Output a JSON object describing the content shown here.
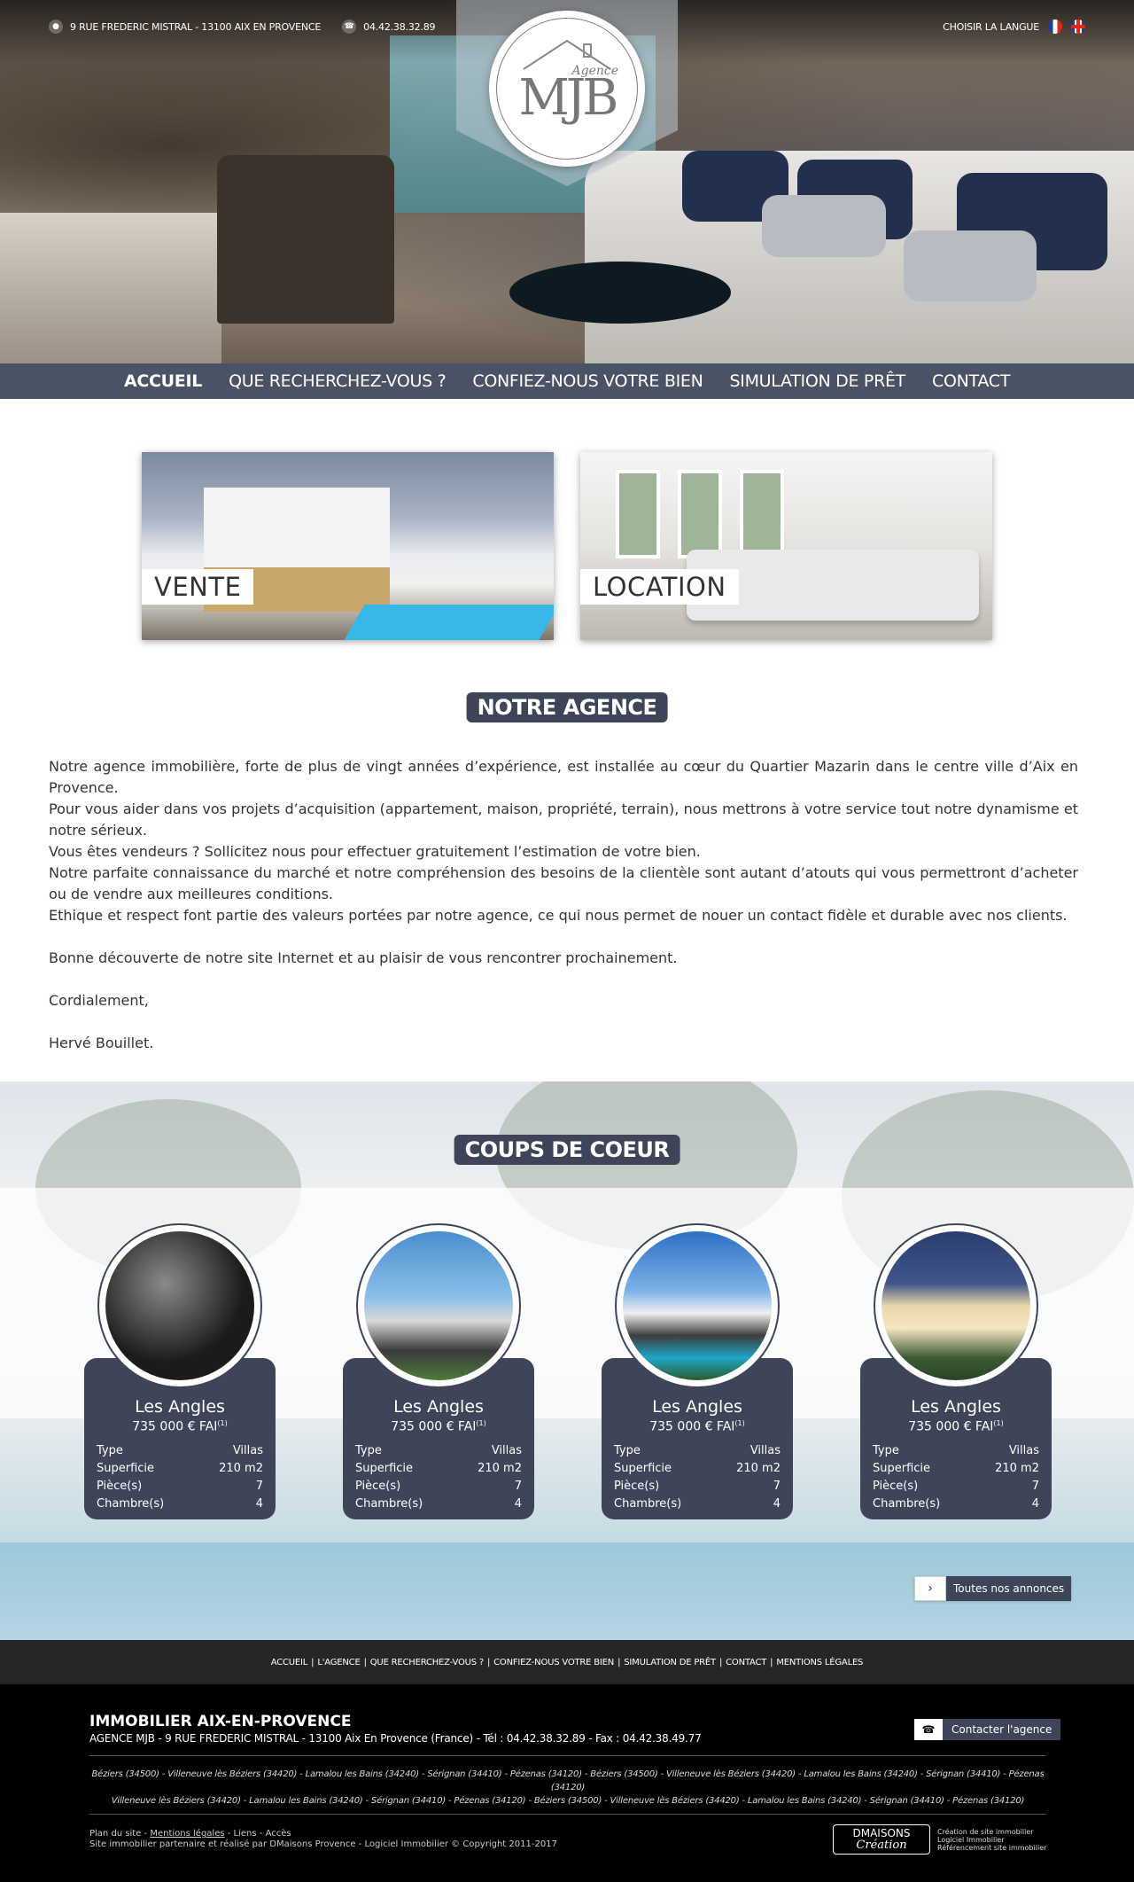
{
  "topbar": {
    "address": "9 RUE FREDERIC MISTRAL - 13100 AIX EN PROVENCE",
    "phone": "04.42.38.32.89",
    "language_label": "CHOISIR LA LANGUE"
  },
  "logo": {
    "text": "MJB",
    "subtitle": "Agence"
  },
  "nav": [
    {
      "label": "ACCUEIL",
      "active": true
    },
    {
      "label": "QUE RECHERCHEZ-VOUS ?"
    },
    {
      "label": "CONFIEZ-NOUS VOTRE BIEN"
    },
    {
      "label": "SIMULATION DE PRÊT"
    },
    {
      "label": "CONTACT"
    }
  ],
  "tiles": {
    "vente": "VENTE",
    "location": "LOCATION"
  },
  "agency": {
    "title": "NOTRE AGENCE",
    "paragraphs": [
      "Notre agence immobilière, forte de plus de vingt années d’expérience, est installée au cœur du Quartier Mazarin dans le centre ville d’Aix en Provence.",
      "Pour vous aider dans vos projets d’acquisition (appartement, maison, propriété, terrain), nous mettrons à votre service tout notre dynamisme et notre sérieux.",
      "Vous êtes vendeurs ? Sollicitez nous pour effectuer gratuitement l’estimation de votre bien.",
      "Notre parfaite connaissance du marché et notre compréhension des besoins de la clientèle sont autant d’atouts qui vous permettront d’acheter ou de vendre aux meilleures conditions.",
      "Ethique et respect font partie des valeurs portées par notre agence, ce qui nous permet de nouer un contact fidèle et durable avec nos clients."
    ],
    "closing": "Bonne découverte de notre site Internet et au plaisir de vous rencontrer prochainement.",
    "regards": "Cordialement,",
    "signature": "Hervé Bouillet."
  },
  "favorites": {
    "title": "COUPS DE COEUR",
    "labels": {
      "type": "Type",
      "surface": "Superficie",
      "rooms": "Pièce(s)",
      "bedrooms": "Chambre(s)"
    },
    "cards": [
      {
        "city": "Les Angles",
        "price": "735 000 € FAI",
        "price_note": "(1)",
        "type": "Villas",
        "surface": "210 m2",
        "rooms": "7",
        "bedrooms": "4"
      },
      {
        "city": "Les Angles",
        "price": "735 000 € FAI",
        "price_note": "(1)",
        "type": "Villas",
        "surface": "210 m2",
        "rooms": "7",
        "bedrooms": "4"
      },
      {
        "city": "Les Angles",
        "price": "735 000 € FAI",
        "price_note": "(1)",
        "type": "Villas",
        "surface": "210 m2",
        "rooms": "7",
        "bedrooms": "4"
      },
      {
        "city": "Les Angles",
        "price": "735 000 € FAI",
        "price_note": "(1)",
        "type": "Villas",
        "surface": "210 m2",
        "rooms": "7",
        "bedrooms": "4"
      }
    ],
    "all_listings": "Toutes nos annonces"
  },
  "footer_links": [
    "ACCUEIL",
    "L'AGENCE",
    "QUE RECHERCHEZ-VOUS ?",
    "CONFIEZ-NOUS VOTRE BIEN",
    "SIMULATION DE PRÊT",
    "CONTACT",
    "MENTIONS LÉGALES"
  ],
  "footer": {
    "title": "IMMOBILIER AIX-EN-PROVENCE",
    "address": "AGENCE MJB - 9 RUE FREDERIC MISTRAL - 13100 Aix En Provence (France) - Tél : 04.42.38.32.89 - Fax : 04.42.38.49.77",
    "contact_button": "Contacter l'agence",
    "towns_line1": "Béziers (34500) - Villeneuve lès Béziers (34420) - Lamalou les Bains (34240) - Sérignan (34410) - Pézenas (34120) - Béziers (34500) - Villeneuve lès Béziers (34420) - Lamalou les Bains (34240) - Sérignan (34410) - Pézenas (34120)",
    "towns_line2": "Villeneuve lès Béziers (34420) - Lamalou les Bains (34240) - Sérignan (34410) - Pézenas (34120) - Béziers (34500) - Villeneuve lès Béziers (34420) - Lamalou les Bains (34240) - Sérignan (34410) - Pézenas (34120)",
    "plan": "Plan du site",
    "mentions": "Mentions légales",
    "liens": "Liens",
    "acces": "Accès",
    "credit": "Site immobilier partenaire et réalisé par DMaisons Provence - Logiciel Immobilier © Copyright 2011-2017",
    "dm_name": "DMAISONS",
    "dm_sub": "Création",
    "dm_lines": [
      "Création de site immobilier",
      "Logiciel Immobilier",
      "Référencement site immobilier"
    ]
  },
  "colors": {
    "navy": "#3e4558",
    "nav_bar": "#4a5266",
    "footer_dark": "#262626"
  }
}
